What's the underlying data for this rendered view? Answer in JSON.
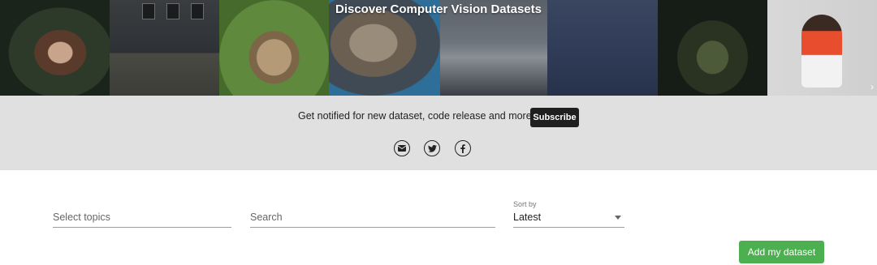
{
  "hero": {
    "title": "Discover Computer Vision Datasets",
    "next_arrow": "›"
  },
  "notify": {
    "text": "Get notified for new dataset, code release and more",
    "subscribe_label": "Subscribe",
    "social_icons": [
      "email-icon",
      "twitter-icon",
      "facebook-icon"
    ]
  },
  "filters": {
    "topics_placeholder": "Select topics",
    "search_placeholder": "Search",
    "sort_caption": "Sort by",
    "sort_value": "Latest"
  },
  "actions": {
    "add_dataset_label": "Add my dataset"
  },
  "colors": {
    "notify_band": "#e0e0e0",
    "subscribe_bg": "#1f1f1f",
    "add_button": "#4caf50"
  }
}
